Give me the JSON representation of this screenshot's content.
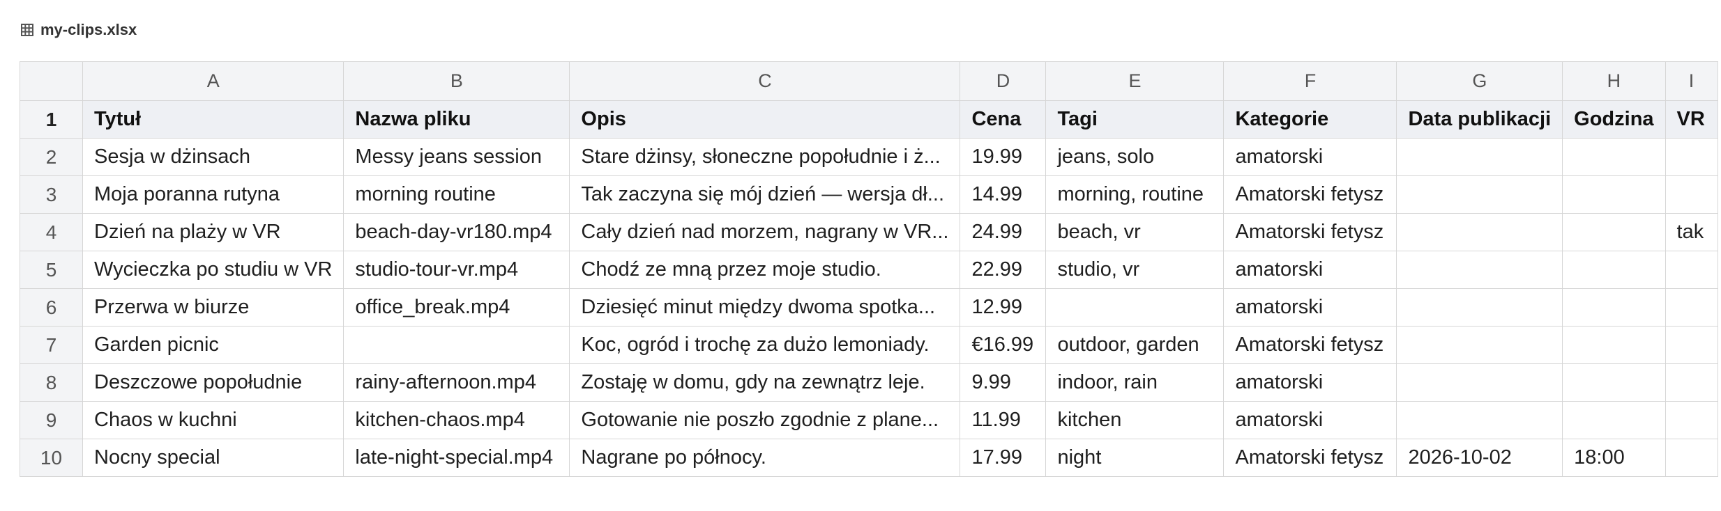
{
  "file": {
    "icon": "spreadsheet-icon",
    "name": "my-clips.xlsx"
  },
  "sheet": {
    "column_letters": [
      "A",
      "B",
      "C",
      "D",
      "E",
      "F",
      "G",
      "H",
      "I"
    ],
    "header_row_number": "1",
    "headers": [
      "Tytuł",
      "Nazwa pliku",
      "Opis",
      "Cena",
      "Tagi",
      "Kategorie",
      "Data publikacji",
      "Godzina",
      "VR"
    ],
    "rows": [
      {
        "num": "2",
        "cells": [
          "Sesja w dżinsach",
          "Messy jeans session",
          "Stare dżinsy, słoneczne popołudnie i ż...",
          "19.99",
          "jeans, solo",
          "amatorski",
          "",
          "",
          ""
        ]
      },
      {
        "num": "3",
        "cells": [
          "Moja poranna rutyna",
          "morning routine",
          "Tak zaczyna się mój dzień — wersja dł...",
          "14.99",
          "morning, routine",
          "Amatorski fetysz",
          "",
          "",
          ""
        ]
      },
      {
        "num": "4",
        "cells": [
          "Dzień na plaży w VR",
          "beach-day-vr180.mp4",
          "Cały dzień nad morzem, nagrany w VR...",
          "24.99",
          "beach, vr",
          "Amatorski fetysz",
          "",
          "",
          "tak"
        ]
      },
      {
        "num": "5",
        "cells": [
          "Wycieczka po studiu w VR",
          "studio-tour-vr.mp4",
          "Chodź ze mną przez moje studio.",
          "22.99",
          "studio, vr",
          "amatorski",
          "",
          "",
          ""
        ]
      },
      {
        "num": "6",
        "cells": [
          "Przerwa w biurze",
          "office_break.mp4",
          "Dziesięć minut między dwoma spotka...",
          "12.99",
          "",
          "amatorski",
          "",
          "",
          ""
        ]
      },
      {
        "num": "7",
        "cells": [
          "Garden picnic",
          "",
          "Koc, ogród i trochę za dużo lemoniady.",
          "€16.99",
          "outdoor, garden",
          "Amatorski fetysz",
          "",
          "",
          ""
        ]
      },
      {
        "num": "8",
        "cells": [
          "Deszczowe popołudnie",
          "rainy-afternoon.mp4",
          "Zostaję w domu, gdy na zewnątrz leje.",
          "9.99",
          "indoor, rain",
          "amatorski",
          "",
          "",
          ""
        ]
      },
      {
        "num": "9",
        "cells": [
          "Chaos w kuchni",
          "kitchen-chaos.mp4",
          "Gotowanie nie poszło zgodnie z plane...",
          "11.99",
          "kitchen",
          "amatorski",
          "",
          "",
          ""
        ]
      },
      {
        "num": "10",
        "cells": [
          "Nocny special",
          "late-night-special.mp4",
          "Nagrane po północy.",
          "17.99",
          "night",
          "Amatorski fetysz",
          "2026-10-02",
          "18:00",
          ""
        ]
      }
    ]
  }
}
